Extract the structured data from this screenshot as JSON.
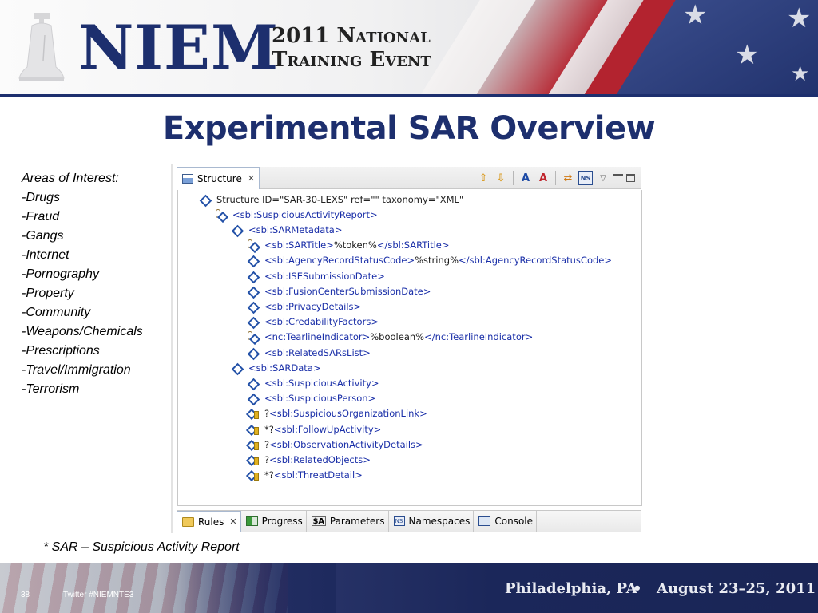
{
  "banner": {
    "logo_text": "NIEM",
    "event_line1": "2011 National",
    "event_line2": "Training Event"
  },
  "slide": {
    "title": "Experimental SAR Overview"
  },
  "areas": {
    "heading": "Areas of Interest:",
    "items": [
      "-Drugs",
      "-Fraud",
      "-Gangs",
      "-Internet",
      "-Pornography",
      "-Property",
      "-Community",
      "-Weapons/Chemicals",
      "-Prescriptions",
      "-Travel/Immigration",
      "-Terrorism"
    ]
  },
  "eclipse": {
    "tab_label": "Structure",
    "tab_close": "✕",
    "toolbar": {
      "move_up": "⇧",
      "move_down": "⇩",
      "expand": "A",
      "collapse": "A",
      "sync": "⇄",
      "ns": "NS",
      "menu": "▽"
    },
    "tree": [
      {
        "icon": "diamond",
        "indent": 0,
        "parts": [
          {
            "c": "t-dark",
            "t": "Structure ID=\"SAR-30-LEXS\" ref=\"\" taxonomy=\"XML\""
          }
        ]
      },
      {
        "icon": "clip",
        "indent": 1,
        "parts": [
          {
            "c": "t-blue",
            "t": "<sbl:SuspiciousActivityReport>"
          }
        ]
      },
      {
        "icon": "diamond",
        "indent": 2,
        "parts": [
          {
            "c": "t-blue",
            "t": "<sbl:SARMetadata>"
          }
        ]
      },
      {
        "icon": "clip",
        "indent": 3,
        "parts": [
          {
            "c": "t-blue",
            "t": "<sbl:SARTitle>"
          },
          {
            "c": "t-black",
            "t": " %token%"
          },
          {
            "c": "t-blue",
            "t": "</sbl:SARTitle>"
          }
        ]
      },
      {
        "icon": "diamond",
        "indent": 3,
        "parts": [
          {
            "c": "t-blue",
            "t": "<sbl:AgencyRecordStatusCode>"
          },
          {
            "c": "t-black",
            "t": " %string%"
          },
          {
            "c": "t-blue",
            "t": "</sbl:AgencyRecordStatusCode>"
          }
        ]
      },
      {
        "icon": "diamond",
        "indent": 3,
        "parts": [
          {
            "c": "t-blue",
            "t": "<sbl:ISESubmissionDate>"
          }
        ]
      },
      {
        "icon": "diamond",
        "indent": 3,
        "parts": [
          {
            "c": "t-blue",
            "t": "<sbl:FusionCenterSubmissionDate>"
          }
        ]
      },
      {
        "icon": "diamond",
        "indent": 3,
        "parts": [
          {
            "c": "t-blue",
            "t": "<sbl:PrivacyDetails>"
          }
        ]
      },
      {
        "icon": "diamond",
        "indent": 3,
        "parts": [
          {
            "c": "t-blue",
            "t": "<sbl:CredabilityFactors>"
          }
        ]
      },
      {
        "icon": "clip",
        "indent": 3,
        "parts": [
          {
            "c": "t-blue",
            "t": "<nc:TearlineIndicator>"
          },
          {
            "c": "t-black",
            "t": " %boolean%"
          },
          {
            "c": "t-blue",
            "t": "</nc:TearlineIndicator>"
          }
        ]
      },
      {
        "icon": "diamond",
        "indent": 3,
        "parts": [
          {
            "c": "t-blue",
            "t": "<sbl:RelatedSARsList>"
          }
        ]
      },
      {
        "icon": "diamond",
        "indent": 2,
        "parts": [
          {
            "c": "t-blue",
            "t": "<sbl:SARData>"
          }
        ]
      },
      {
        "icon": "diamond",
        "indent": 3,
        "parts": [
          {
            "c": "t-blue",
            "t": "<sbl:SuspiciousActivity>"
          }
        ]
      },
      {
        "icon": "diamond",
        "indent": 3,
        "parts": [
          {
            "c": "t-blue",
            "t": "<sbl:SuspiciousPerson>"
          }
        ]
      },
      {
        "icon": "opt",
        "indent": 3,
        "parts": [
          {
            "c": "t-black",
            "t": "? "
          },
          {
            "c": "t-blue",
            "t": "<sbl:SuspiciousOrganizationLink>"
          }
        ]
      },
      {
        "icon": "opt",
        "indent": 3,
        "parts": [
          {
            "c": "t-black",
            "t": "*? "
          },
          {
            "c": "t-blue",
            "t": "<sbl:FollowUpActivity>"
          }
        ]
      },
      {
        "icon": "opt",
        "indent": 3,
        "parts": [
          {
            "c": "t-black",
            "t": "? "
          },
          {
            "c": "t-blue",
            "t": "<sbl:ObservationActivityDetails>"
          }
        ]
      },
      {
        "icon": "opt",
        "indent": 3,
        "parts": [
          {
            "c": "t-black",
            "t": "? "
          },
          {
            "c": "t-blue",
            "t": "<sbl:RelatedObjects>"
          }
        ]
      },
      {
        "icon": "opt",
        "indent": 3,
        "parts": [
          {
            "c": "t-black",
            "t": "*? "
          },
          {
            "c": "t-blue",
            "t": "<sbl:ThreatDetail>"
          }
        ]
      }
    ],
    "bottom_tabs": [
      {
        "name": "rules",
        "icon": "folder",
        "label": "Rules",
        "close": "✕",
        "active": true
      },
      {
        "name": "progress",
        "icon": "progress",
        "label": "Progress",
        "active": false
      },
      {
        "name": "parameters",
        "icon": "params",
        "icon_text": "$A",
        "label": "Parameters",
        "active": false
      },
      {
        "name": "namespaces",
        "icon": "ns",
        "icon_text": "NS",
        "label": "Namespaces",
        "active": false
      },
      {
        "name": "console",
        "icon": "console",
        "label": "Console",
        "active": false
      }
    ]
  },
  "footnote": "* SAR – Suspicious Activity Report",
  "footer": {
    "page_number": "38",
    "twitter": "Twitter #NIEMNTE3",
    "location": "Philadelphia, PA",
    "bullet": "•",
    "dates": "August 23–25, 2011"
  }
}
